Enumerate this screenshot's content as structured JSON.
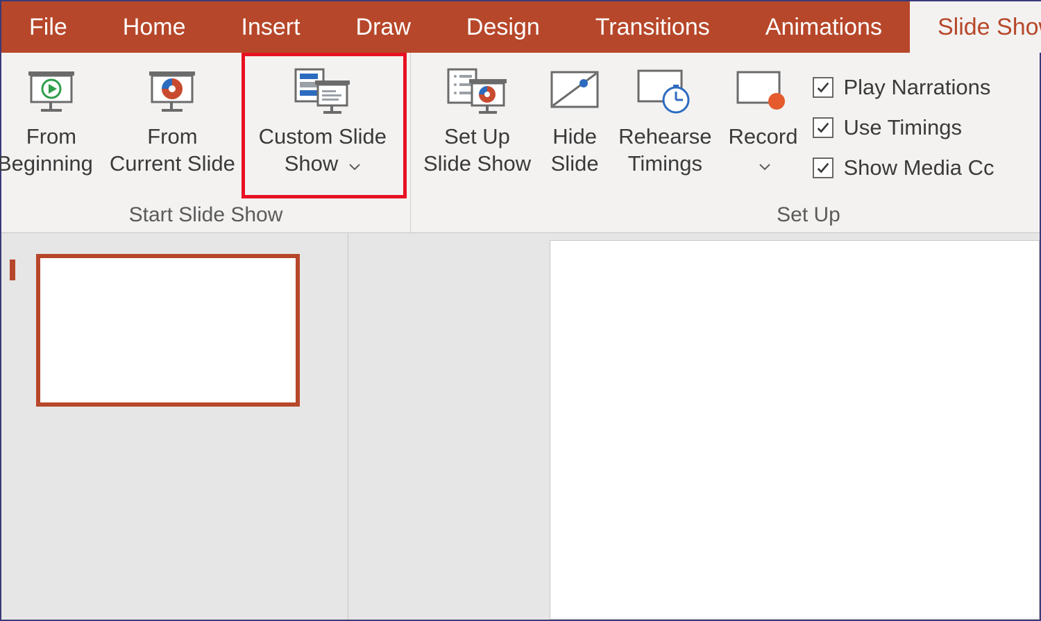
{
  "tabs": {
    "file": "File",
    "home": "Home",
    "insert": "Insert",
    "draw": "Draw",
    "design": "Design",
    "transitions": "Transitions",
    "animations": "Animations",
    "slide_show": "Slide Show"
  },
  "ribbon": {
    "group_start": "Start Slide Show",
    "group_setup": "Set Up",
    "from_beginning": {
      "line1": "From",
      "line2": "Beginning"
    },
    "from_current": {
      "line1": "From",
      "line2": "Current Slide"
    },
    "custom_show": {
      "line1": "Custom Slide",
      "line2": "Show"
    },
    "set_up": {
      "line1": "Set Up",
      "line2": "Slide Show"
    },
    "hide_slide": {
      "line1": "Hide",
      "line2": "Slide"
    },
    "rehearse": {
      "line1": "Rehearse",
      "line2": "Timings"
    },
    "record": {
      "line1": "Record",
      "line2": ""
    },
    "play_narrations": "Play Narrations",
    "use_timings": "Use Timings",
    "show_media": "Show Media Cc"
  }
}
